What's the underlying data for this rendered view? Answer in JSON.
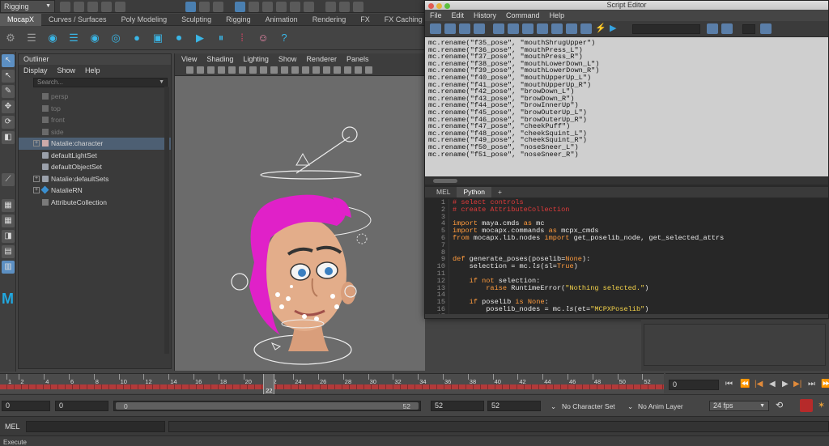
{
  "topbar": {
    "mode_menu": "Rigging"
  },
  "shelf_tabs": [
    "MocapX",
    "Curves / Surfaces",
    "Poly Modeling",
    "Sculpting",
    "Rigging",
    "Animation",
    "Rendering",
    "FX",
    "FX Caching"
  ],
  "outliner": {
    "title": "Outliner",
    "menu": [
      "Display",
      "Show",
      "Help"
    ],
    "search_placeholder": "Search...",
    "items": [
      {
        "label": "persp",
        "icon": "camera-icon"
      },
      {
        "label": "top",
        "icon": "camera-icon"
      },
      {
        "label": "front",
        "icon": "camera-icon"
      },
      {
        "label": "side",
        "icon": "camera-icon"
      },
      {
        "label": "Natalie:character",
        "icon": "character-icon"
      },
      {
        "label": "defaultLightSet",
        "icon": "set-icon"
      },
      {
        "label": "defaultObjectSet",
        "icon": "set-icon"
      },
      {
        "label": "Natalie:defaultSets",
        "icon": "set-icon"
      },
      {
        "label": "NatalieRN",
        "icon": "reference-icon"
      },
      {
        "label": "AttributeCollection",
        "icon": "node-icon"
      }
    ]
  },
  "viewport": {
    "menu": [
      "View",
      "Shading",
      "Lighting",
      "Show",
      "Renderer",
      "Panels"
    ]
  },
  "script_editor": {
    "title": "Script Editor",
    "menu": [
      "File",
      "Edit",
      "History",
      "Command",
      "Help"
    ],
    "output_lines": [
      "mc.rename(\"f35_pose\", \"mouthShrugUpper\")",
      "mc.rename(\"f36_pose\", \"mouthPress_L\")",
      "mc.rename(\"f37_pose\", \"mouthPress_R\")",
      "mc.rename(\"f38_pose\", \"mouthLowerDown_L\")",
      "mc.rename(\"f39_pose\", \"mouthLowerDown_R\")",
      "mc.rename(\"f40_pose\", \"mouthUpperUp_L\")",
      "mc.rename(\"f41_pose\", \"mouthUpperUp_R\")",
      "mc.rename(\"f42_pose\", \"browDown_L\")",
      "mc.rename(\"f43_pose\", \"browDown_R\")",
      "mc.rename(\"f44_pose\", \"browInnerUp\")",
      "mc.rename(\"f45_pose\", \"browOuterUp_L\")",
      "mc.rename(\"f46_pose\", \"browOuterUp_R\")",
      "mc.rename(\"f47_pose\", \"cheekPuff\")",
      "mc.rename(\"f48_pose\", \"cheekSquint_L\")",
      "mc.rename(\"f49_pose\", \"cheekSquint_R\")",
      "mc.rename(\"f50_pose\", \"noseSneer_L\")",
      "mc.rename(\"f51_pose\", \"noseSneer_R\")"
    ],
    "tabs": [
      "MEL",
      "Python",
      "+"
    ],
    "active_tab": "Python",
    "code_lines": [
      {
        "n": "1",
        "html": "<span class=\"c-com\"># select controls</span>"
      },
      {
        "n": "2",
        "html": "<span class=\"c-com\"># create AttributeCollection</span>"
      },
      {
        "n": "3",
        "html": ""
      },
      {
        "n": "4",
        "html": "<span class=\"c-kw\">import</span> maya.cmds <span class=\"c-kw\">as</span> mc"
      },
      {
        "n": "5",
        "html": "<span class=\"c-kw\">import</span> mocapx.commands <span class=\"c-kw\">as</span> mcpx_cmds"
      },
      {
        "n": "6",
        "html": "<span class=\"c-kw\">from</span> mocapx.lib.nodes <span class=\"c-kw\">import</span> get_poselib_node, get_selected_attrs"
      },
      {
        "n": "7",
        "html": ""
      },
      {
        "n": "8",
        "html": ""
      },
      {
        "n": "9",
        "html": "<span class=\"c-kw\">def</span> generate_poses(poselib=<span class=\"c-bi\">None</span>):"
      },
      {
        "n": "10",
        "html": "    selection = mc.<i>ls</i>(sl=<span class=\"c-bi\">True</span>)"
      },
      {
        "n": "11",
        "html": ""
      },
      {
        "n": "12",
        "html": "    <span class=\"c-kw\">if not</span> selection:"
      },
      {
        "n": "13",
        "html": "        <span class=\"c-kw\">raise</span> RuntimeError(<span class=\"c-str\">\"Nothing selected.\"</span>)"
      },
      {
        "n": "14",
        "html": ""
      },
      {
        "n": "15",
        "html": "    <span class=\"c-kw\">if</span> poselib <span class=\"c-kw\">is</span> <span class=\"c-bi\">None</span>:"
      },
      {
        "n": "16",
        "html": "        poselib_nodes = mc.<i>ls</i>(et=<span class=\"c-str\">\"MCPXPoselib\"</span>)"
      },
      {
        "n": "17",
        "html": ""
      }
    ]
  },
  "timeline": {
    "ticks": [
      {
        "f": 1,
        "label": "1"
      },
      {
        "f": 2,
        "label": "2"
      },
      {
        "f": 4,
        "label": "4"
      },
      {
        "f": 6,
        "label": "6"
      },
      {
        "f": 8,
        "label": "8"
      },
      {
        "f": 10,
        "label": "10"
      },
      {
        "f": 12,
        "label": "12"
      },
      {
        "f": 14,
        "label": "14"
      },
      {
        "f": 16,
        "label": "16"
      },
      {
        "f": 18,
        "label": "18"
      },
      {
        "f": 20,
        "label": "20"
      },
      {
        "f": 22,
        "label": "22"
      },
      {
        "f": 24,
        "label": "24"
      },
      {
        "f": 26,
        "label": "26"
      },
      {
        "f": 28,
        "label": "28"
      },
      {
        "f": 30,
        "label": "30"
      },
      {
        "f": 32,
        "label": "32"
      },
      {
        "f": 34,
        "label": "34"
      },
      {
        "f": 36,
        "label": "36"
      },
      {
        "f": 38,
        "label": "38"
      },
      {
        "f": 40,
        "label": "40"
      },
      {
        "f": 42,
        "label": "42"
      },
      {
        "f": 44,
        "label": "44"
      },
      {
        "f": 46,
        "label": "46"
      },
      {
        "f": 48,
        "label": "48"
      },
      {
        "f": 50,
        "label": "50"
      },
      {
        "f": 52,
        "label": "52"
      }
    ],
    "current_frame": "22",
    "current_frame_field": "0"
  },
  "range": {
    "start": "0",
    "anim_start": "0",
    "slider_start": "0",
    "slider_end": "52",
    "anim_end": "52",
    "end": "52",
    "character_set": "No Character Set",
    "anim_layer": "No Anim Layer",
    "fps": "24 fps"
  },
  "command_line": {
    "label": "MEL"
  },
  "help_line": "Execute",
  "colors": {
    "accent": "#3ab6e6",
    "keyframes": "#b23a3a",
    "hair": "#e021c8"
  }
}
